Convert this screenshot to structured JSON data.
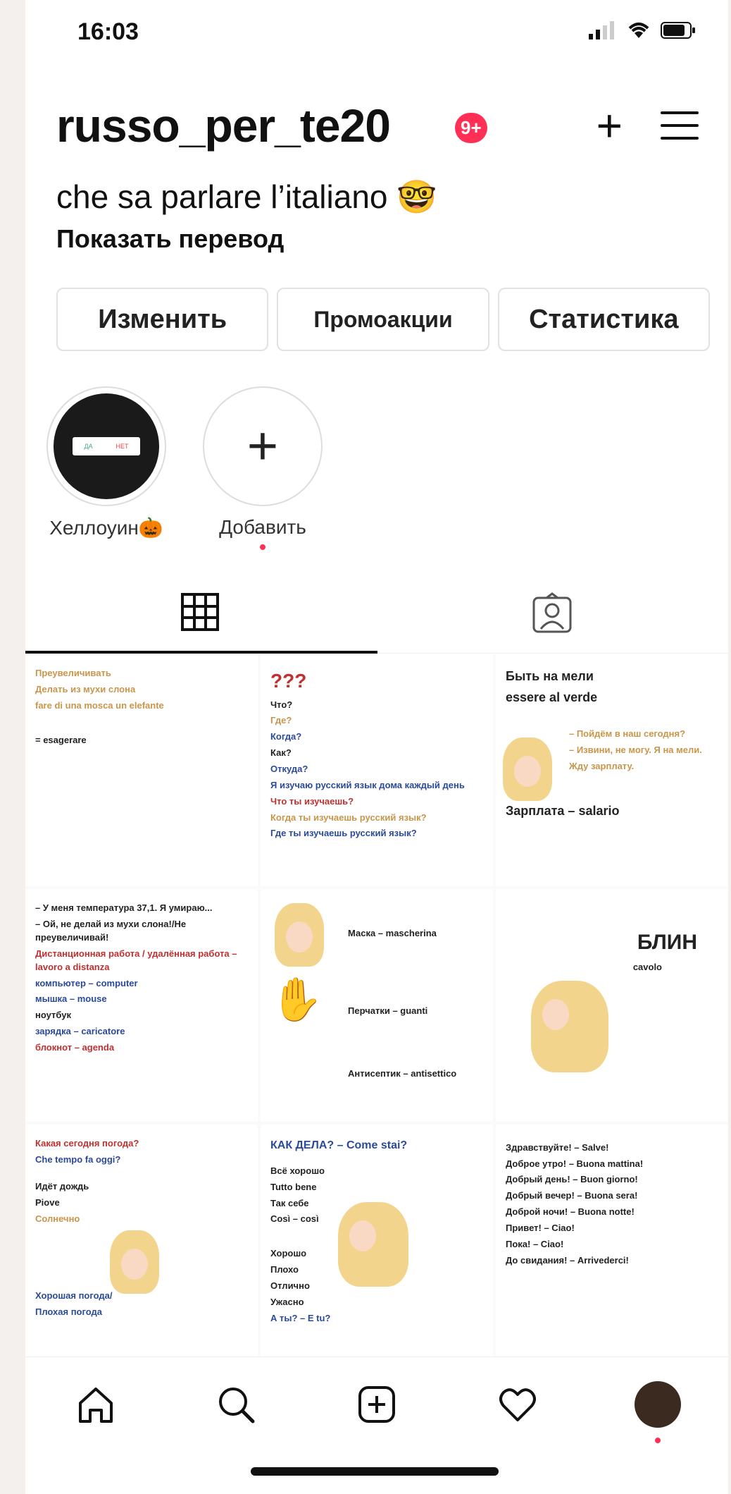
{
  "status": {
    "time": "16:03"
  },
  "profile": {
    "username": "russo_per_te20",
    "notification_badge": "9+",
    "bio": "che sa parlare l’italiano",
    "bio_emoji": "🤓",
    "translate_link": "Показать перевод"
  },
  "actions": {
    "edit": "Изменить",
    "promotions": "Промоакции",
    "insights": "Статистика"
  },
  "highlights": [
    {
      "label": "Хеллоуин",
      "emoji": "🎃",
      "card_yes": "ДА",
      "card_no": "НЕТ"
    },
    {
      "label": "Добавить"
    }
  ],
  "posts": [
    {
      "lines": [
        "Преувеличивать",
        "Делать из мухи слона",
        "fare di una mosca un elefante",
        "= esagerare"
      ]
    },
    {
      "lines": [
        "Что?",
        "Где?",
        "Когда?",
        "Как?",
        "Откуда?",
        "Я изучаю русский язык дома каждый день",
        "Что ты изучаешь?",
        "Когда ты изучаешь русский язык?",
        "Где ты изучаешь русский язык?"
      ],
      "big": "???"
    },
    {
      "lines": [
        "Быть на мели",
        "essere al verde",
        "– Пойдём в наш сегодня?",
        "– Извини, не могу. Я на мели.",
        "Жду зарплату.",
        "Зарплата – salario"
      ]
    },
    {
      "lines": [
        "– У меня температура 37,1. Я умираю...",
        "– Ой, не делай из мухи слона!/Не преувеличивай!",
        "Дистанционная работа / удалённая работа – lavoro a distanza",
        "компьютер – computer",
        "мышка – mouse",
        "ноутбук",
        "зарядка – caricatore",
        "блокнот – agenda"
      ]
    },
    {
      "lines": [
        "Маска – mascherina",
        "Перчатки – guanti",
        "Антисептик – antisettico"
      ]
    },
    {
      "lines": [
        "БЛИН",
        "cavolo"
      ]
    },
    {
      "lines": [
        "Какая сегодня погода?",
        "Che tempo fa oggi?",
        "Идёт дождь",
        "Piove",
        "Солнечно",
        "Хорошая погода/",
        "Плохая погода"
      ]
    },
    {
      "lines": [
        "КАК ДЕЛА? – Come stai?",
        "Всё хорошо",
        "Tutto bene",
        "Так себе",
        "Così – così",
        "Хорошо",
        "Плохо",
        "Отлично",
        "Ужасно",
        "А ты? – E tu?"
      ]
    },
    {
      "lines": [
        "Здравствуйте! – Salve!",
        "Доброе утро! – Buona mattina!",
        "Добрый день! – Buon giorno!",
        "Добрый вечер! – Buona sera!",
        "Доброй ночи! – Buona notte!",
        "Привет! – Ciao!",
        "Пока! – Ciao!",
        "До свидания! – Arrivederci!"
      ]
    }
  ]
}
